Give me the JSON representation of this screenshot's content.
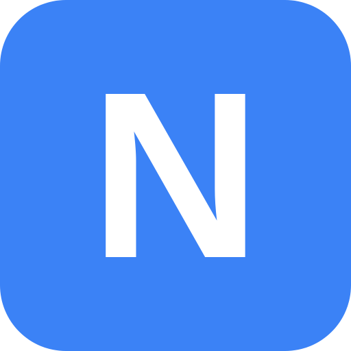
{
  "icon": {
    "letter": "N",
    "background_color": "#3b82f6",
    "letter_color": "#ffffff"
  }
}
